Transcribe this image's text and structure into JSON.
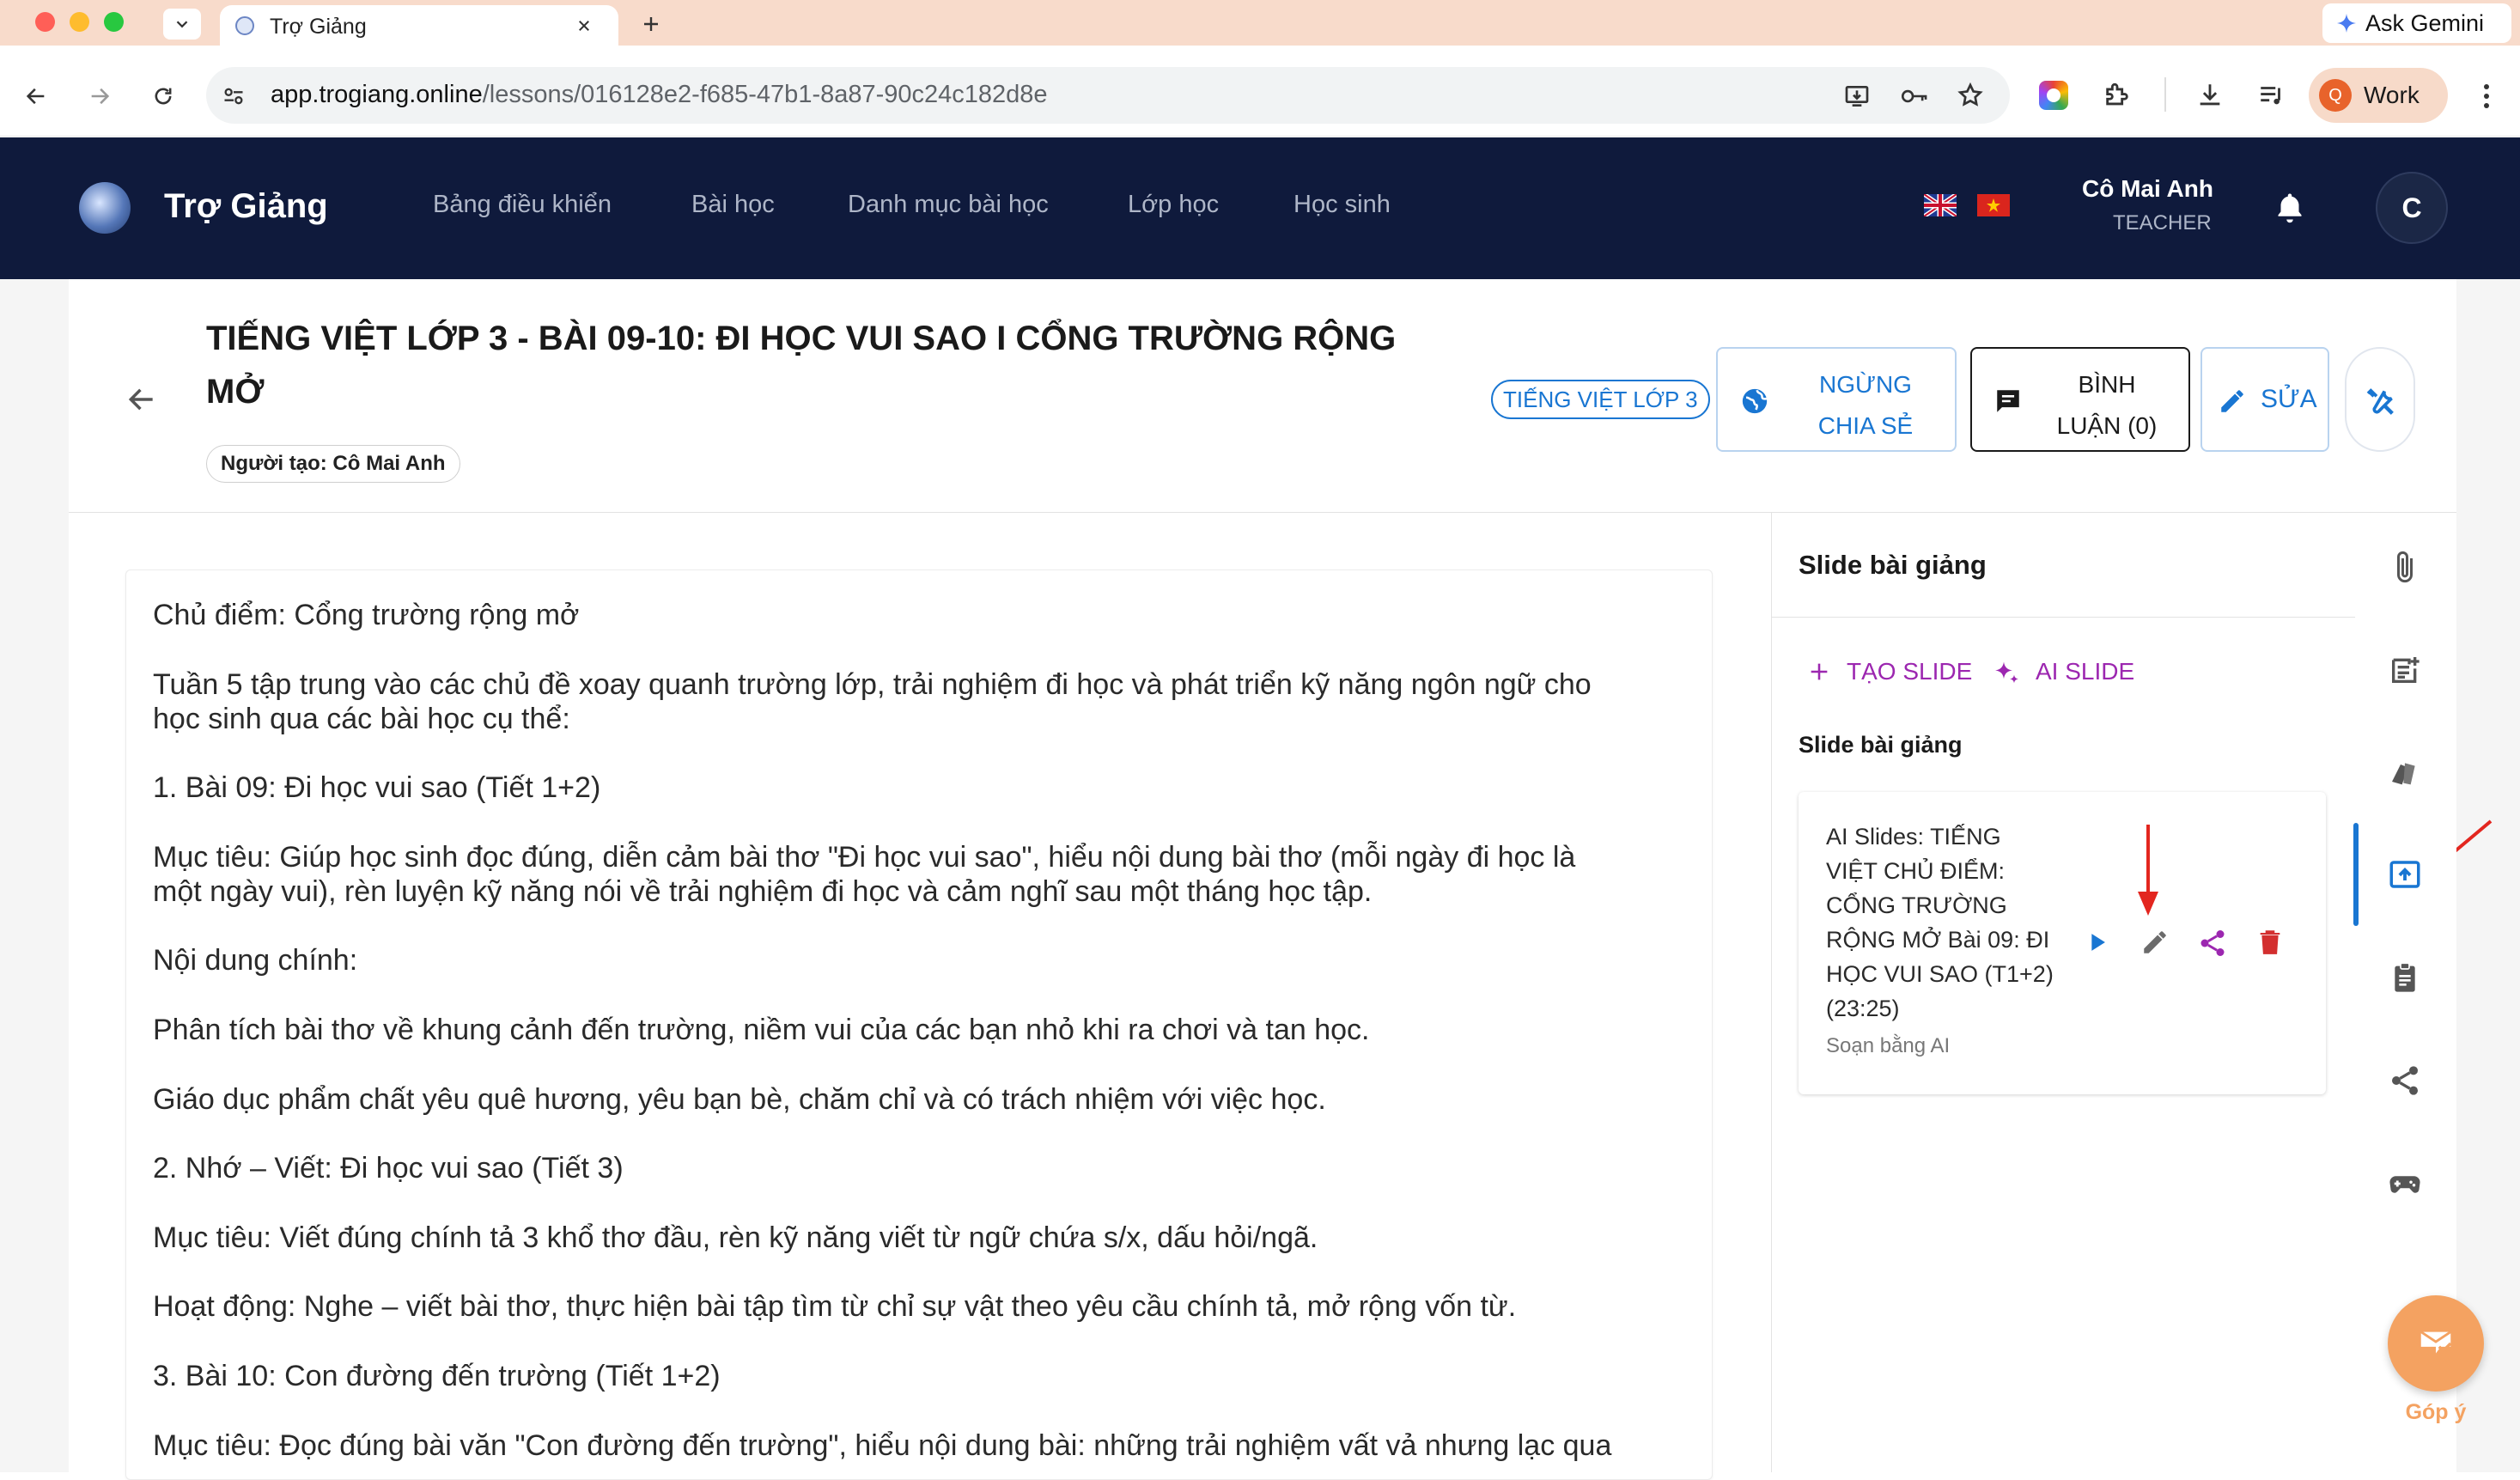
{
  "browser": {
    "tab_title": "Trợ Giảng",
    "url_domain": "app.trogiang.online",
    "url_path": "/lessons/016128e2-f685-47b1-8a87-90c24c182d8e",
    "ask_gemini": "Ask Gemini",
    "profile_initial": "Q",
    "profile_label": "Work"
  },
  "app": {
    "brand": "Trợ Giảng",
    "nav": [
      "Bảng điều khiển",
      "Bài học",
      "Danh mục bài học",
      "Lớp học",
      "Học sinh"
    ],
    "user_name": "Cô Mai Anh",
    "user_role": "TEACHER",
    "avatar_initial": "C"
  },
  "lesson": {
    "title_line1": "TIẾNG VIỆT LỚP 3 - BÀI 09-10: ĐI HỌC VUI SAO I CỔNG TRƯỜNG RỘNG",
    "title_line2": "MỞ",
    "creator": "Người tạo: Cô Mai Anh",
    "tag": "TIẾNG VIỆT LỚP 3",
    "stop_share_line1": "NGỪNG",
    "stop_share_line2": "CHIA SẺ",
    "comment_line1": "BÌNH",
    "comment_line2": "LUẬN (0)",
    "edit": "SỬA"
  },
  "content": {
    "paragraphs": [
      "Chủ điểm: Cổng trường rộng mở",
      "Tuần 5 tập trung vào các chủ đề xoay quanh trường lớp, trải nghiệm đi học và phát triển kỹ năng ngôn ngữ cho",
      "học sinh qua các bài học cụ thể:",
      "1. Bài 09: Đi học vui sao (Tiết 1+2)",
      "Mục tiêu: Giúp học sinh đọc đúng, diễn cảm bài thơ \"Đi học vui sao\", hiểu nội dung bài thơ (mỗi ngày đi học là",
      "một ngày vui), rèn luyện kỹ năng nói về trải nghiệm đi học và cảm nghĩ sau một tháng học tập.",
      "Nội dung chính:",
      "Phân tích bài thơ về khung cảnh đến trường, niềm vui của các bạn nhỏ khi ra chơi và tan học.",
      "Giáo dục phẩm chất yêu quê hương, yêu bạn bè, chăm chỉ và có trách nhiệm với việc học.",
      "2. Nhớ – Viết: Đi học vui sao (Tiết 3)",
      "Mục tiêu: Viết đúng chính tả 3 khổ thơ đầu, rèn kỹ năng viết từ ngữ chứa s/x, dấu hỏi/ngã.",
      "Hoạt động: Nghe – viết bài thơ, thực hiện bài tập tìm từ chỉ sự vật theo yêu cầu chính tả, mở rộng vốn từ.",
      "3. Bài 10: Con đường đến trường (Tiết 1+2)",
      "Mục tiêu: Đọc đúng bài văn \"Con đường đến trường\", hiểu nội dung bài: những trải nghiệm vất vả nhưng lạc qua"
    ]
  },
  "panel": {
    "title": "Slide bài giảng",
    "create_slide": "TẠO SLIDE",
    "ai_slide": "AI SLIDE",
    "section_label": "Slide bài giảng",
    "slide_lines": [
      "AI Slides: TIẾNG",
      "VIỆT CHỦ ĐIỂM:",
      "CỔNG TRƯỜNG",
      "RỘNG MỞ Bài 09: ĐI",
      "HỌC VUI SAO (T1+2)",
      "(23:25)"
    ],
    "slide_caption": "Soạn bằng AI"
  },
  "feedback": {
    "label": "Góp ý"
  },
  "colors": {
    "navy": "#0f1a3c",
    "purple": "#9c27b0",
    "red": "#d32f2f",
    "blue": "#1976d2",
    "orange": "#f4a261"
  }
}
